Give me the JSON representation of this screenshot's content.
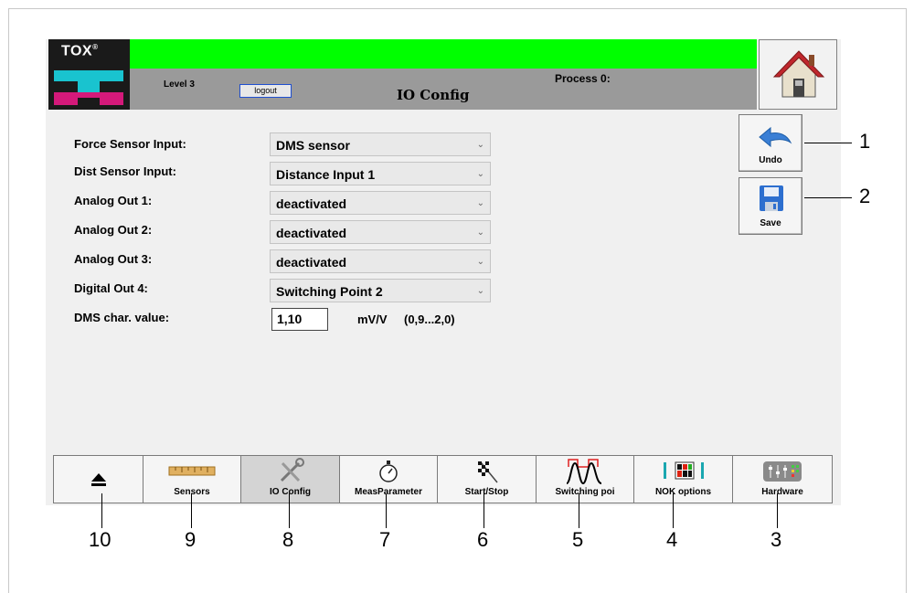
{
  "header": {
    "logo_text": "TOX",
    "level": "Level 3",
    "logout_label": "logout",
    "process": "Process 0:",
    "title": "IO Config",
    "status_color": "#00ff00"
  },
  "side_buttons": {
    "undo_label": "Undo",
    "save_label": "Save"
  },
  "form": {
    "force_label": "Force Sensor Input:",
    "force_value": "DMS sensor",
    "dist_label": "Dist Sensor Input:",
    "dist_value": "Distance Input 1",
    "ao1_label": "Analog Out 1:",
    "ao1_value": "deactivated",
    "ao2_label": "Analog Out 2:",
    "ao2_value": "deactivated",
    "ao3_label": "Analog Out 3:",
    "ao3_value": "deactivated",
    "do4_label": "Digital Out 4:",
    "do4_value": "Switching Point 2",
    "dms_label": "DMS char. value:",
    "dms_value": "1,10",
    "dms_unit": "mV/V",
    "dms_range": "(0,9...2,0)"
  },
  "tabs": [
    {
      "label": ""
    },
    {
      "label": "Sensors"
    },
    {
      "label": "IO Config"
    },
    {
      "label": "MeasParameter"
    },
    {
      "label": "Start/Stop"
    },
    {
      "label": "Switching poi"
    },
    {
      "label": "NOK options"
    },
    {
      "label": "Hardware"
    }
  ],
  "callouts": [
    "1",
    "2",
    "3",
    "4",
    "5",
    "6",
    "7",
    "8",
    "9",
    "10"
  ]
}
